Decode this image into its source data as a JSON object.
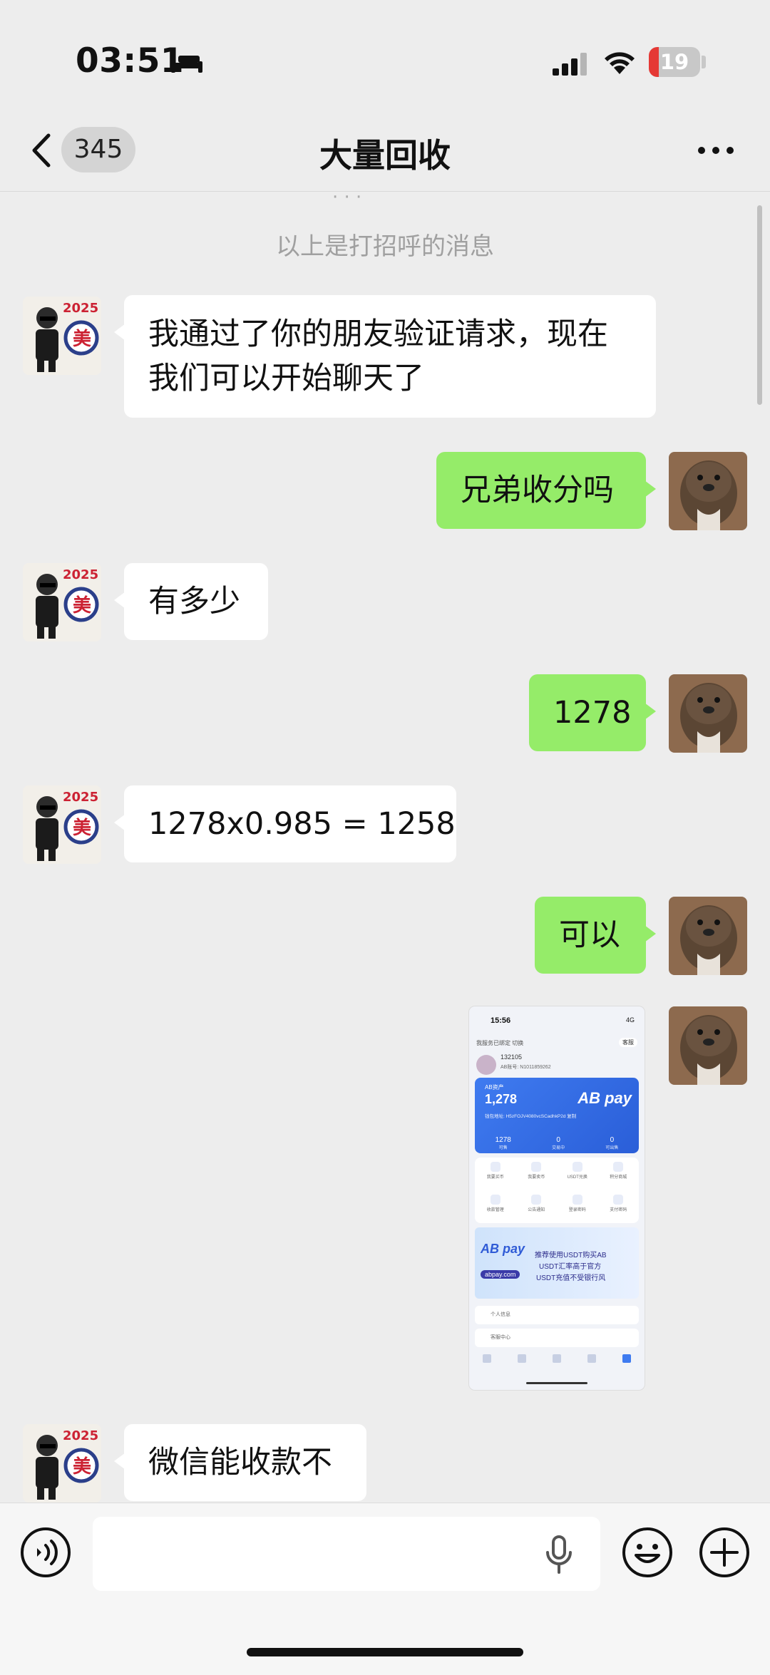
{
  "status_bar": {
    "time": "03:51",
    "battery": "19",
    "battery_level": 0.19
  },
  "header": {
    "unread_count": "345",
    "title": "大量回收"
  },
  "system_message": "以上是打招呼的消息",
  "messages": [
    {
      "side": "in",
      "lines": [
        "我通过了你的朋友验证请求，现在",
        "我们可以开始聊天了"
      ]
    },
    {
      "side": "out",
      "text": "兄弟收分吗"
    },
    {
      "side": "in",
      "text": "有多少"
    },
    {
      "side": "out",
      "text": "1278"
    },
    {
      "side": "in",
      "text": "1278x0.985 = 1258"
    },
    {
      "side": "out",
      "text": "可以"
    },
    {
      "side": "out",
      "type": "image"
    },
    {
      "side": "in",
      "text": "微信能收款不"
    }
  ],
  "thumbnail": {
    "time": "15:56",
    "status": "4G",
    "top_left": "我服务已绑定  切换",
    "service": "客服",
    "username": "132105",
    "uid": "AB账号: N1011859262",
    "asset_label": "AB资产",
    "amount": "1,278",
    "address": "钱包地址: H5zFOJV4080vcSCadhkP2d 复制",
    "brand": "AB pay",
    "stats": [
      {
        "value": "1278",
        "label": "可售"
      },
      {
        "value": "0",
        "label": "交易中"
      },
      {
        "value": "0",
        "label": "可出售"
      }
    ],
    "grid": [
      "我要买币",
      "我要卖币",
      "USDT兑换",
      "积分商城",
      "收款管理",
      "公告通知",
      "登录密码",
      "支付密码"
    ],
    "banner_logo": "AB pay",
    "banner_domain": "abpay.com",
    "banner_lines": [
      "推荐使用USDT购买AB",
      "USDT汇率高于官方",
      "USDT充值不受银行风"
    ],
    "list": [
      "个人信息",
      "客服中心"
    ]
  }
}
